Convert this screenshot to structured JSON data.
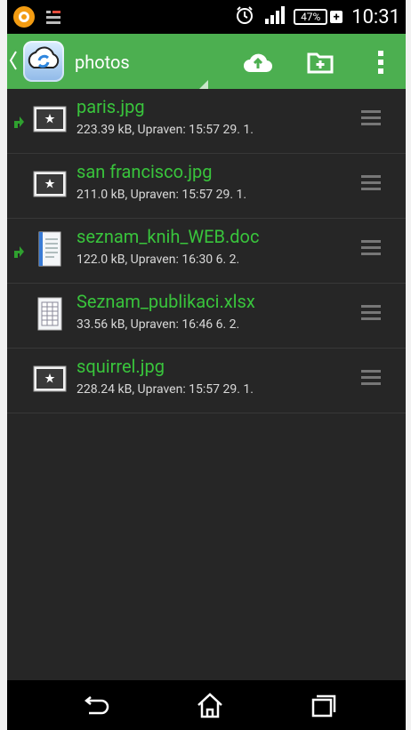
{
  "status_bar": {
    "time": "10:31",
    "battery_percent": "47%",
    "icons": [
      "app-notification-icon",
      "keyboard-notification-icon",
      "alarm-clock-icon",
      "signal-strength-icon",
      "battery-icon"
    ]
  },
  "action_bar": {
    "title": "photos",
    "icons": [
      "back-chevron-icon",
      "app-sync-logo-icon",
      "spinner-triangle-icon",
      "cloud-upload-icon",
      "new-folder-icon",
      "overflow-menu-icon"
    ]
  },
  "files": [
    {
      "name": "paris.jpg",
      "meta": "223.39 kB, Upraven: 15:57 29. 1.",
      "type": "image",
      "synced": true
    },
    {
      "name": "san francisco.jpg",
      "meta": "211.0 kB, Upraven: 15:57 29. 1.",
      "type": "image",
      "synced": false
    },
    {
      "name": "seznam_knih_WEB.doc",
      "meta": "122.0 kB, Upraven: 16:30 6. 2.",
      "type": "document",
      "synced": true
    },
    {
      "name": "Seznam_publikaci.xlsx",
      "meta": "33.56 kB, Upraven: 16:46 6. 2.",
      "type": "spreadsheet",
      "synced": false
    },
    {
      "name": "squirrel.jpg",
      "meta": "228.24 kB, Upraven: 15:57 29. 1.",
      "type": "image",
      "synced": false
    }
  ],
  "colors": {
    "accent": "#4caf50",
    "file_name": "#39c43c",
    "list_background": "#262626"
  }
}
